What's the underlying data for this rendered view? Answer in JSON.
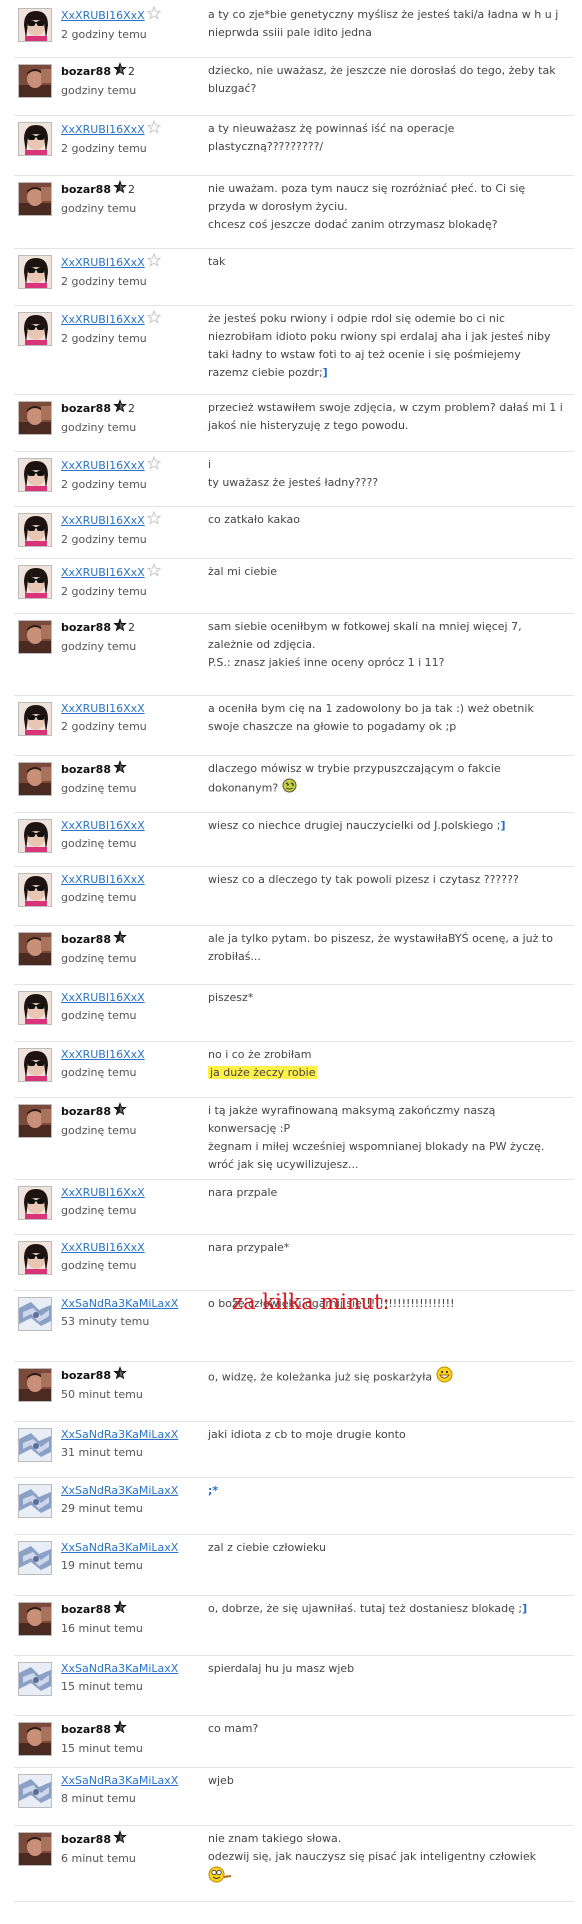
{
  "separator": "za kilka minut:",
  "users": {
    "r": "XxXRUBI16XxX",
    "b": "bozar88",
    "s": "XxSaNdRa3KaMiLaxX"
  },
  "rows": [
    {
      "u": "r",
      "star": true,
      "rank": "",
      "time": "2 godziny temu",
      "text": "a ty co zje*bie genetyczny myślisz że jesteś taki/a ładna w h u j nieprwda ssiii pale idito jedna"
    },
    {
      "u": "b",
      "star": true,
      "rank": "2",
      "time": "godziny temu",
      "text": "dziecko, nie uważasz, że jeszcze nie dorosłaś do tego, żeby tak bluzgać?"
    },
    {
      "u": "r",
      "star": true,
      "rank": "",
      "time": "2 godziny temu",
      "text": "a ty nieuważasz żę powinnaś iść na operacje plastyczną?????????/"
    },
    {
      "u": "b",
      "star": true,
      "rank": "2",
      "time": "godziny temu",
      "text": "nie uważam. poza tym naucz się rozróżniać płeć. to Ci się przyda w dorosłym życiu.\nchcesz coś jeszcze dodać zanim otrzymasz blokadę?"
    },
    {
      "u": "r",
      "star": true,
      "rank": "",
      "time": "2 godziny temu",
      "text": "tak"
    },
    {
      "u": "r",
      "star": true,
      "rank": "",
      "time": "2 godziny temu",
      "text": "że jesteś poku rwiony i odpie rdol się odemie bo ci nic niezrobiłam idioto poku rwiony spi erdalaj aha i jak jesteś niby taki ładny to wstaw foti to aj też ocenie i się pośmiejemy razemz ciebie pozdr;",
      "smile": "]"
    },
    {
      "u": "b",
      "star": true,
      "rank": "2",
      "time": "godziny temu",
      "text": "przecież wstawiłem swoje zdjęcia, w czym problem? dałaś mi 1 i jakoś nie histeryzuję z tego powodu."
    },
    {
      "u": "r",
      "star": true,
      "rank": "",
      "time": "2 godziny temu",
      "text": "i\nty uważasz że jesteś ładny????"
    },
    {
      "u": "r",
      "star": true,
      "rank": "",
      "time": "2 godziny temu",
      "text": "co zatkało kakao"
    },
    {
      "u": "r",
      "star": true,
      "rank": "",
      "time": "2 godziny temu",
      "text": "żal mi ciebie"
    },
    {
      "u": "b",
      "star": true,
      "rank": "2",
      "time": "godziny temu",
      "text": "sam siebie oceniłbym w fotkowej skali na mniej więcej 7, zależnie od zdjęcia.\nP.S.: znasz jakieś inne oceny oprócz 1 i 11?"
    },
    {
      "u": "r",
      "star": false,
      "rank": "",
      "time": "2 godziny temu",
      "text": "a oceniła bym cię na 1 zadowolony bo ja tak :) weż obetnik swoje chaszcze na głowie to pogadamy ok ;p"
    },
    {
      "u": "b",
      "star": true,
      "rank": "",
      "time": "godzinę temu",
      "text": "dlaczego mówisz w trybie przypuszczającym o fakcie dokonanym?",
      "emoji": "dizzy"
    },
    {
      "u": "r",
      "star": false,
      "rank": "",
      "time": "godzinę temu",
      "text": "wiesz co niechce drugiej nauczycielki od J.polskiego ;",
      "smile": "]"
    },
    {
      "u": "r",
      "star": false,
      "rank": "",
      "time": "godzinę temu",
      "text": "wiesz co a dleczego ty tak powoli pizesz i czytasz ??????"
    },
    {
      "u": "b",
      "star": true,
      "rank": "",
      "time": "godzinę temu",
      "text": "ale ja tylko pytam. bo piszesz, że wystawiłaBYŚ ocenę, a już to zrobiłaś..."
    },
    {
      "u": "r",
      "star": false,
      "rank": "",
      "time": "godzinę temu",
      "text": "piszesz*"
    },
    {
      "u": "r",
      "star": false,
      "rank": "",
      "time": "godzinę temu",
      "text": "no i co że zrobiłam",
      "highlight": "ja duże żeczy robie"
    },
    {
      "u": "b",
      "star": true,
      "rank": "",
      "time": "godzinę temu",
      "text": "i tą jakże wyrafinowaną maksymą zakończmy naszą konwersację :P\nżegnam i miłej wcześniej wspomnianej blokady na PW życzę.\nwróć jak się ucywilizujesz..."
    },
    {
      "u": "r",
      "star": false,
      "rank": "",
      "time": "godzinę temu",
      "text": "nara przpale"
    },
    {
      "u": "r",
      "star": false,
      "rank": "",
      "time": "godzinę temu",
      "text": "nara przypale*"
    },
    {
      "u": "s",
      "star": false,
      "rank": "",
      "time": "53 minuty temu",
      "text": "o boże człowieku ogarnij się!!!!!!!!!!!!!!!!!!!!!"
    },
    {
      "u": "b",
      "star": true,
      "rank": "",
      "time": "50 minut temu",
      "text": "o, widzę, że koleżanka już się poskarżyła",
      "emoji": "grin"
    },
    {
      "u": "s",
      "star": false,
      "rank": "",
      "time": "31 minut temu",
      "text": "jaki idiota z cb to moje drugie konto"
    },
    {
      "u": "s",
      "star": false,
      "rank": "",
      "time": "29 minut temu",
      "text": "",
      "smile": ";*"
    },
    {
      "u": "s",
      "star": false,
      "rank": "",
      "time": "19 minut temu",
      "text": "zal z ciebie człowieku"
    },
    {
      "u": "b",
      "star": true,
      "rank": "",
      "time": "16 minut temu",
      "text": "o, dobrze, że się ujawniłaś. tutaj też dostaniesz blokadę ;",
      "smile": "]"
    },
    {
      "u": "s",
      "star": false,
      "rank": "",
      "time": "15 minut temu",
      "text": "spierdalaj hu ju masz wjeb"
    },
    {
      "u": "b",
      "star": true,
      "rank": "",
      "time": "15 minut temu",
      "text": "co mam?"
    },
    {
      "u": "s",
      "star": false,
      "rank": "",
      "time": "8 minut temu",
      "text": "wjeb"
    },
    {
      "u": "b",
      "star": true,
      "rank": "",
      "time": "6 minut temu",
      "text": "nie znam takiego słowa.\nodezwij się, jak nauczysz się pisać jak inteligentny człowiek",
      "emoji": "nerd"
    }
  ]
}
